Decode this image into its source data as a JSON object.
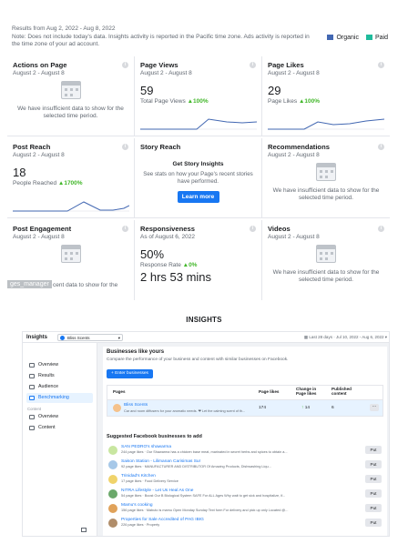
{
  "note": {
    "results_from": "Results from Aug 2, 2022 - Aug 8, 2022",
    "text": "Note: Does not include today's data. Insights activity is reported in the Pacific time zone. Ads activity is reported in the time zone of your ad account."
  },
  "legend": [
    {
      "label": "Organic",
      "color": "#4267b2"
    },
    {
      "label": "Paid",
      "color": "#1fbb9c"
    }
  ],
  "cards": {
    "actions": {
      "title": "Actions on Page",
      "date": "August 2 - August 8",
      "empty": "We have insufficient data to show for the selected time period."
    },
    "views": {
      "title": "Page Views",
      "date": "August 2 - August 8",
      "value": "59",
      "label": "Total Page Views",
      "change": "100%"
    },
    "likes": {
      "title": "Page Likes",
      "date": "August 2 - August 8",
      "value": "29",
      "label": "Page Likes",
      "change": "100%"
    },
    "reach": {
      "title": "Post Reach",
      "date": "August 2 - August 8",
      "value": "18",
      "label": "People Reached",
      "change": "1700%"
    },
    "story": {
      "title": "Story Reach",
      "heading": "Get Story Insights",
      "text": "See stats on how your Page's recent stories have performed.",
      "button": "Learn more"
    },
    "recs": {
      "title": "Recommendations",
      "date": "August 2 - August 8",
      "empty": "We have insufficient data to show for the selected time period."
    },
    "engagement": {
      "title": "Post Engagement",
      "date": "August 2 - August 8",
      "tag": "ges_manager",
      "empty": "cent data to show for the"
    },
    "responsiveness": {
      "title": "Responsiveness",
      "date": "As of August 6, 2022",
      "value": "50%",
      "label": "Response Rate",
      "change": "0%",
      "time": "2 hrs 53 mins"
    },
    "videos": {
      "title": "Videos",
      "date": "August 2 - August 8",
      "empty": "We have insufficient data to show for the selected time period."
    }
  },
  "caption": "INSIGHTS",
  "bottom": {
    "title": "Insights",
    "page_select": "Bliss Scents",
    "date_range": "Last 28 days · Jul 10, 2022 - Aug 6, 2022",
    "sidebar": [
      {
        "label": "Overview"
      },
      {
        "label": "Results"
      },
      {
        "label": "Audience"
      },
      {
        "label": "Benchmarking"
      }
    ],
    "sidebar_section": "Content",
    "sidebar2": [
      {
        "label": "Overview"
      },
      {
        "label": "Content"
      }
    ],
    "main": {
      "heading": "Businesses like yours",
      "text": "Compare the performance of your business and content with similar businesses on Facebook.",
      "enter_button": "Enter businesses",
      "columns": [
        "Pages",
        "Page likes",
        "Change in Page likes",
        "Published content"
      ],
      "row": {
        "name": "Bliss Scents",
        "desc": "Car and room diffusers for your aromatic needs. ❤ Let the calming scent of th...",
        "likes": "174",
        "change": "14",
        "published": "6"
      },
      "suggested_heading": "Suggested Facebook businesses to add",
      "suggested": [
        {
          "name": "SAN PEDRO's shawarma",
          "desc": "244 page likes · Our Shawarma has a chicken base meat, marinated in secret herbs and spices to obtain a...",
          "button": "Put"
        },
        {
          "name": "Saison Station - Lilimanan Carisimas Sur",
          "desc": "92 page likes · MANUFACTURER AND DISTRIBUTOR Of Amazing Products, Dishwashing Liqu...",
          "button": "Put"
        },
        {
          "name": "Trinidad's Kitchen",
          "desc": "17 page likes · Food Delivery Service",
          "button": "Put"
        },
        {
          "name": "NITRA Lifestyle - Let Us Heal As One",
          "desc": "54 page likes · Boost Our B Biological System SAFE For ALL Ages Why wait to get sick and hospitalize, if...",
          "button": "Put"
        },
        {
          "name": "Mamu's cooking",
          "desc": "156 page likes · Mabuto is mamu Open Monday Sunday Text form For delivery and pick up only Located @...",
          "button": "Put"
        },
        {
          "name": "Properties for Sale Accredited of PAG IBIG",
          "desc": "226 page likes · Property",
          "button": "Put"
        }
      ]
    }
  }
}
